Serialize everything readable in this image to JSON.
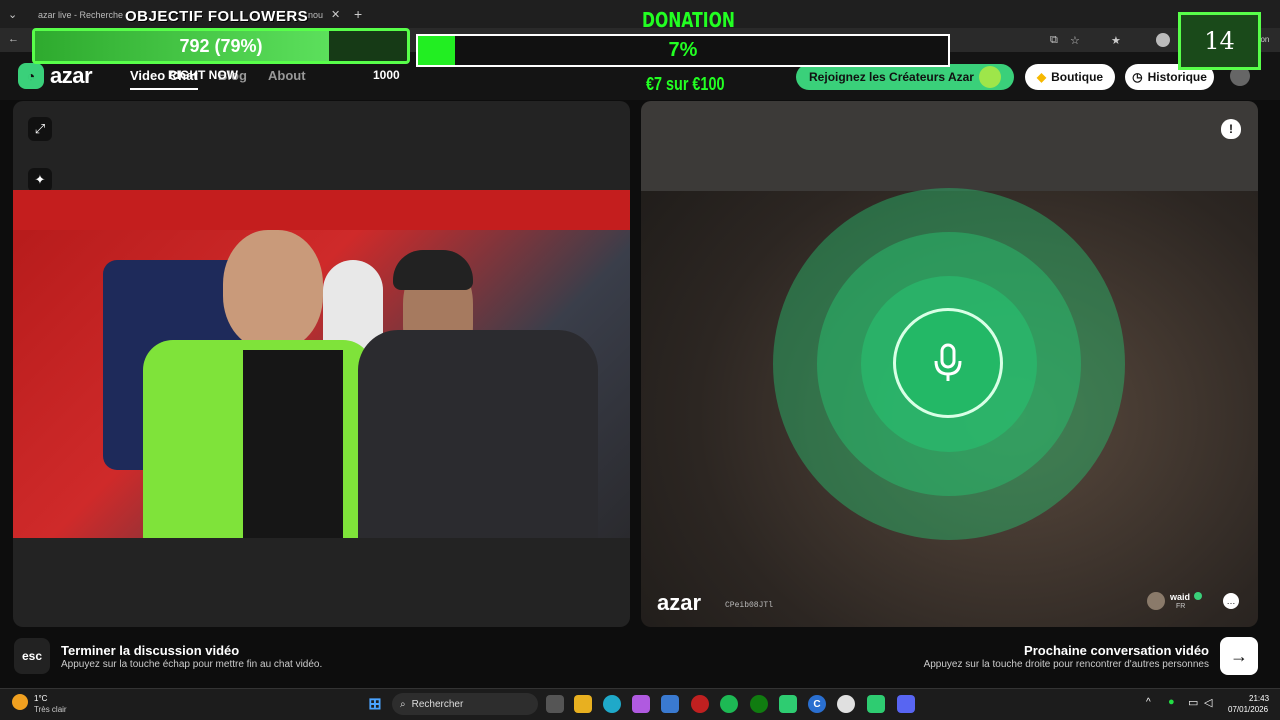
{
  "browser": {
    "tab_label": "azar live - Recherche",
    "tab_label_2": "nou",
    "address_suffix": "onversation"
  },
  "overlay": {
    "followers_title": "OBJECTIF FOLLOWERS",
    "followers_value": "792 (79%)",
    "followers_progress": 0.79,
    "donation_title": "DONATION",
    "donation_pct": "7%",
    "donation_progress": 0.07,
    "donation_sub": "€7 sur €100",
    "counter": "14",
    "right_now": "RIGHT NOW",
    "goal": "1000"
  },
  "site": {
    "logo": "azar",
    "nav": [
      "Video Chat",
      "Blog",
      "About"
    ],
    "creators_cta": "Rejoignez les Créateurs Azar",
    "boutique": "Boutique",
    "historique": "Historique"
  },
  "remote": {
    "watermark": "azar",
    "code": "CPeib08JTl",
    "user_name": "waid",
    "user_country": "FR"
  },
  "actions": {
    "esc_key": "esc",
    "end_title": "Terminer la discussion vidéo",
    "end_sub": "Appuyez sur la touche échap pour mettre fin au chat vidéo.",
    "next_title": "Prochaine conversation vidéo",
    "next_sub": "Appuyez sur la touche droite pour rencontrer d'autres personnes",
    "next_arrow": "→"
  },
  "taskbar": {
    "weather_temp": "1°C",
    "weather_desc": "Très clair",
    "search_placeholder": "Rechercher",
    "time": "21:43",
    "date": "07/01/2026"
  },
  "colors": {
    "accent_green": "#22ff22",
    "azar_green": "#3ad07a"
  }
}
